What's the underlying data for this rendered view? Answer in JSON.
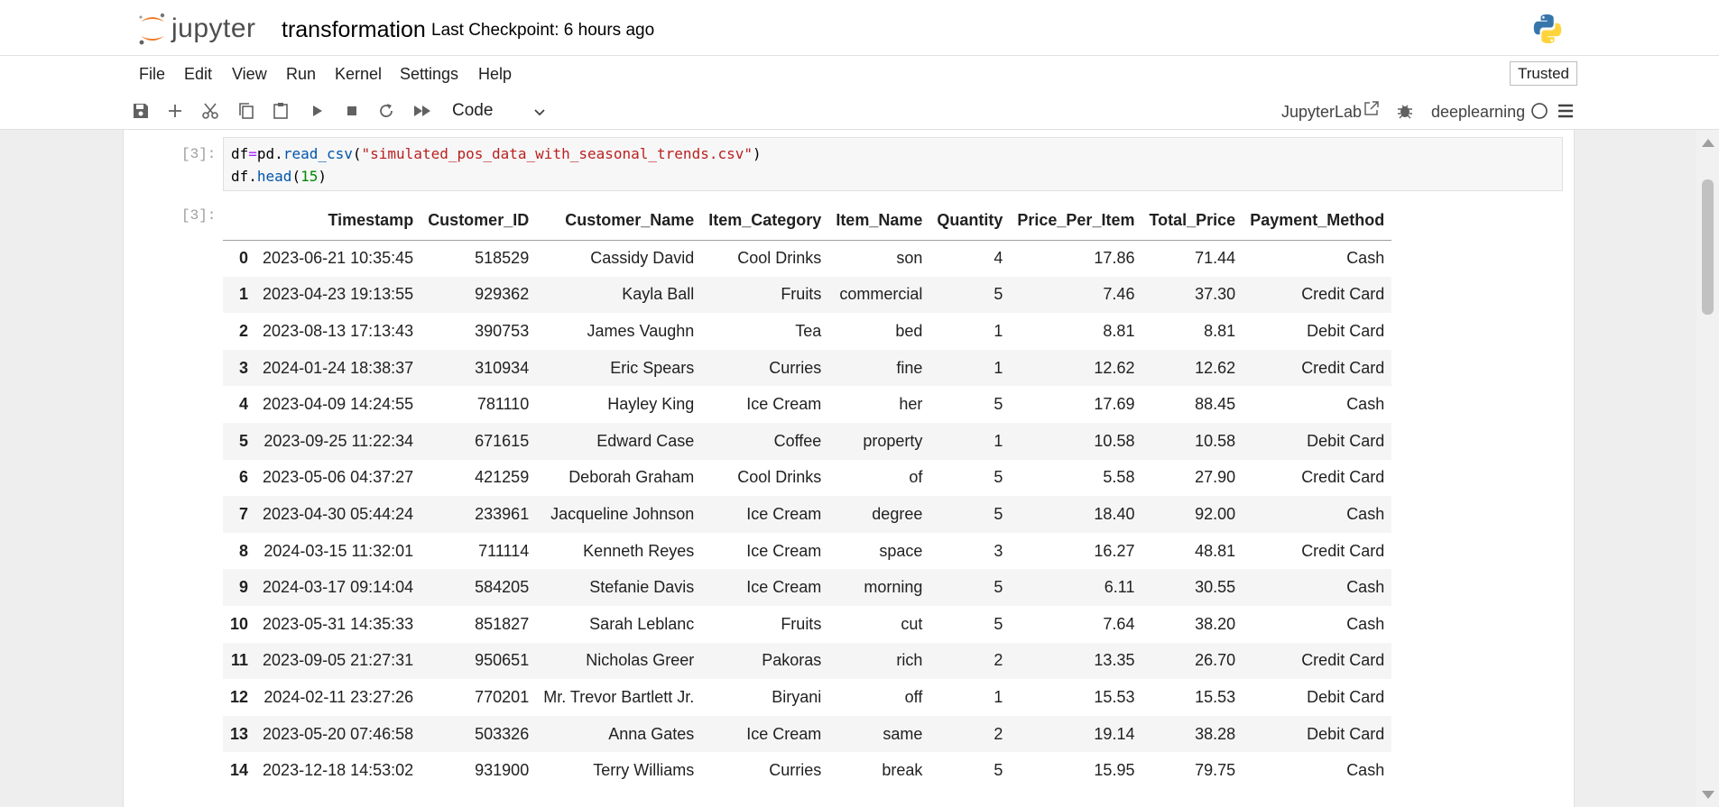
{
  "header": {
    "logo_text": "jupyter",
    "notebook_title": "transformation",
    "checkpoint": "Last Checkpoint: 6 hours ago"
  },
  "menu": {
    "items": [
      "File",
      "Edit",
      "View",
      "Run",
      "Kernel",
      "Settings",
      "Help"
    ],
    "trusted": "Trusted"
  },
  "toolbar": {
    "icons": [
      "save-icon",
      "add-cell-icon",
      "cut-icon",
      "copy-icon",
      "paste-icon",
      "run-icon",
      "stop-icon",
      "restart-icon",
      "fast-forward-icon"
    ],
    "cell_type": "Code",
    "jupyterlab_label": "JupyterLab",
    "kernel_name": "deeplearning"
  },
  "cell": {
    "input_prompt": "[3]:",
    "output_prompt": "[3]:",
    "code": {
      "line1": {
        "var": "df",
        "op": "=",
        "mod": "pd.",
        "fn": "read_csv",
        "open": "(",
        "str": "\"simulated_pos_data_with_seasonal_trends.csv\"",
        "close": ")"
      },
      "line2": {
        "var": "df.",
        "fn": "head",
        "open": "(",
        "num": "15",
        "close": ")"
      }
    }
  },
  "table": {
    "columns": [
      "",
      "Timestamp",
      "Customer_ID",
      "Customer_Name",
      "Item_Category",
      "Item_Name",
      "Quantity",
      "Price_Per_Item",
      "Total_Price",
      "Payment_Method"
    ],
    "rows": [
      [
        "0",
        "2023-06-21 10:35:45",
        "518529",
        "Cassidy David",
        "Cool Drinks",
        "son",
        "4",
        "17.86",
        "71.44",
        "Cash"
      ],
      [
        "1",
        "2023-04-23 19:13:55",
        "929362",
        "Kayla Ball",
        "Fruits",
        "commercial",
        "5",
        "7.46",
        "37.30",
        "Credit Card"
      ],
      [
        "2",
        "2023-08-13 17:13:43",
        "390753",
        "James Vaughn",
        "Tea",
        "bed",
        "1",
        "8.81",
        "8.81",
        "Debit Card"
      ],
      [
        "3",
        "2024-01-24 18:38:37",
        "310934",
        "Eric Spears",
        "Curries",
        "fine",
        "1",
        "12.62",
        "12.62",
        "Credit Card"
      ],
      [
        "4",
        "2023-04-09 14:24:55",
        "781110",
        "Hayley King",
        "Ice Cream",
        "her",
        "5",
        "17.69",
        "88.45",
        "Cash"
      ],
      [
        "5",
        "2023-09-25 11:22:34",
        "671615",
        "Edward Case",
        "Coffee",
        "property",
        "1",
        "10.58",
        "10.58",
        "Debit Card"
      ],
      [
        "6",
        "2023-05-06 04:37:27",
        "421259",
        "Deborah Graham",
        "Cool Drinks",
        "of",
        "5",
        "5.58",
        "27.90",
        "Credit Card"
      ],
      [
        "7",
        "2023-04-30 05:44:24",
        "233961",
        "Jacqueline Johnson",
        "Ice Cream",
        "degree",
        "5",
        "18.40",
        "92.00",
        "Cash"
      ],
      [
        "8",
        "2024-03-15 11:32:01",
        "711114",
        "Kenneth Reyes",
        "Ice Cream",
        "space",
        "3",
        "16.27",
        "48.81",
        "Credit Card"
      ],
      [
        "9",
        "2024-03-17 09:14:04",
        "584205",
        "Stefanie Davis",
        "Ice Cream",
        "morning",
        "5",
        "6.11",
        "30.55",
        "Cash"
      ],
      [
        "10",
        "2023-05-31 14:35:33",
        "851827",
        "Sarah Leblanc",
        "Fruits",
        "cut",
        "5",
        "7.64",
        "38.20",
        "Cash"
      ],
      [
        "11",
        "2023-09-05 21:27:31",
        "950651",
        "Nicholas Greer",
        "Pakoras",
        "rich",
        "2",
        "13.35",
        "26.70",
        "Credit Card"
      ],
      [
        "12",
        "2024-02-11 23:27:26",
        "770201",
        "Mr. Trevor Bartlett Jr.",
        "Biryani",
        "off",
        "1",
        "15.53",
        "15.53",
        "Debit Card"
      ],
      [
        "13",
        "2023-05-20 07:46:58",
        "503326",
        "Anna Gates",
        "Ice Cream",
        "same",
        "2",
        "19.14",
        "38.28",
        "Debit Card"
      ],
      [
        "14",
        "2023-12-18 14:53:02",
        "931900",
        "Terry Williams",
        "Curries",
        "break",
        "5",
        "15.95",
        "79.75",
        "Cash"
      ]
    ]
  }
}
